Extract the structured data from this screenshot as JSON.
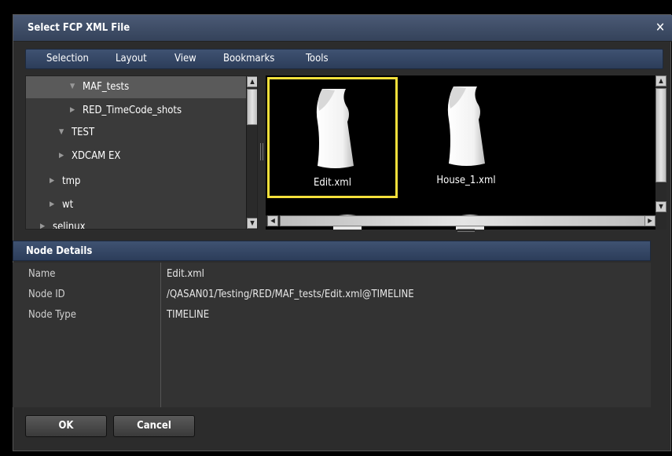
{
  "dialog": {
    "title": "Select FCP XML File"
  },
  "menu": [
    "Selection",
    "Layout",
    "View",
    "Bookmarks",
    "Tools"
  ],
  "tree": {
    "items": [
      {
        "label": "MAF_tests",
        "expanded": true,
        "selected": true
      },
      {
        "label": "RED_TimeCode_shots",
        "expanded": false
      },
      {
        "label": "TEST",
        "expanded": true
      },
      {
        "label": "XDCAM EX",
        "expanded": false
      },
      {
        "label": "tmp",
        "expanded": false
      },
      {
        "label": "wt",
        "expanded": false
      },
      {
        "label": "selinux",
        "expanded": false
      }
    ]
  },
  "files": [
    {
      "name": "Edit.xml",
      "selected": true
    },
    {
      "name": "House_1.xml",
      "selected": false
    }
  ],
  "details": {
    "header": "Node Details",
    "rows": [
      {
        "key": "Name",
        "value": "Edit.xml"
      },
      {
        "key": "Node ID",
        "value": "/QASAN01/Testing/RED/MAF_tests/Edit.xml@TIMELINE"
      },
      {
        "key": "Node Type",
        "value": "TIMELINE"
      }
    ]
  },
  "buttons": {
    "ok": "OK",
    "cancel": "Cancel"
  },
  "colors": {
    "selection_border": "#f4e03b",
    "header_blue": "#3f5272"
  },
  "icons": {
    "close": "close-icon",
    "file": "document-icon"
  }
}
